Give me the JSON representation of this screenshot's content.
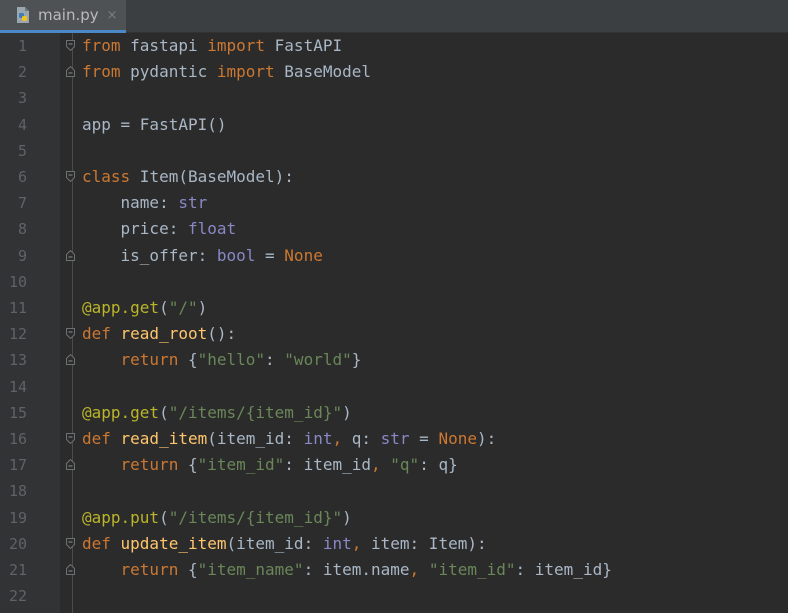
{
  "tab": {
    "filename": "main.py",
    "close_glyph": "×",
    "icon": "python-file-icon"
  },
  "theme": {
    "background": "#2b2b2b",
    "keyword": "#cc7832",
    "decorator": "#bbb529",
    "function": "#ffc66d",
    "string": "#6a8759",
    "builtin": "#8888c6",
    "text": "#a9b7c6"
  },
  "lines": [
    {
      "n": "1",
      "fold": "open",
      "tokens": [
        [
          "kw",
          "from"
        ],
        [
          "t",
          " fastapi "
        ],
        [
          "kw",
          "import"
        ],
        [
          "t",
          " FastAPI"
        ]
      ]
    },
    {
      "n": "2",
      "fold": "end",
      "tokens": [
        [
          "kw",
          "from"
        ],
        [
          "t",
          " pydantic "
        ],
        [
          "kw",
          "import"
        ],
        [
          "t",
          " BaseModel"
        ]
      ]
    },
    {
      "n": "3",
      "fold": "",
      "tokens": []
    },
    {
      "n": "4",
      "fold": "",
      "tokens": [
        [
          "t",
          "app = FastAPI()"
        ]
      ]
    },
    {
      "n": "5",
      "fold": "",
      "tokens": []
    },
    {
      "n": "6",
      "fold": "open",
      "tokens": [
        [
          "kw",
          "class"
        ],
        [
          "t",
          " Item(BaseModel):"
        ]
      ]
    },
    {
      "n": "7",
      "fold": "",
      "tokens": [
        [
          "t",
          "    name: "
        ],
        [
          "bi",
          "str"
        ]
      ]
    },
    {
      "n": "8",
      "fold": "",
      "tokens": [
        [
          "t",
          "    price: "
        ],
        [
          "bi",
          "float"
        ]
      ]
    },
    {
      "n": "9",
      "fold": "end",
      "tokens": [
        [
          "t",
          "    is_offer: "
        ],
        [
          "bi",
          "bool"
        ],
        [
          "t",
          " = "
        ],
        [
          "cst",
          "None"
        ]
      ]
    },
    {
      "n": "10",
      "fold": "",
      "tokens": []
    },
    {
      "n": "11",
      "fold": "",
      "tokens": [
        [
          "dec",
          "@app.get"
        ],
        [
          "t",
          "("
        ],
        [
          "str",
          "\"/\""
        ],
        [
          "t",
          ")"
        ]
      ]
    },
    {
      "n": "12",
      "fold": "open",
      "tokens": [
        [
          "kw",
          "def "
        ],
        [
          "fn",
          "read_root"
        ],
        [
          "t",
          "():"
        ]
      ]
    },
    {
      "n": "13",
      "fold": "end",
      "tokens": [
        [
          "t",
          "    "
        ],
        [
          "kw",
          "return"
        ],
        [
          "t",
          " {"
        ],
        [
          "str",
          "\"hello\""
        ],
        [
          "t",
          ": "
        ],
        [
          "str",
          "\"world\""
        ],
        [
          "t",
          "}"
        ]
      ]
    },
    {
      "n": "14",
      "fold": "",
      "tokens": []
    },
    {
      "n": "15",
      "fold": "",
      "tokens": [
        [
          "dec",
          "@app.get"
        ],
        [
          "t",
          "("
        ],
        [
          "str",
          "\"/items/{item_id}\""
        ],
        [
          "t",
          ")"
        ]
      ]
    },
    {
      "n": "16",
      "fold": "open",
      "tokens": [
        [
          "kw",
          "def "
        ],
        [
          "fn",
          "read_item"
        ],
        [
          "t",
          "(item_id: "
        ],
        [
          "bi",
          "int"
        ],
        [
          "kw",
          ","
        ],
        [
          "t",
          " q: "
        ],
        [
          "bi",
          "str"
        ],
        [
          "t",
          " = "
        ],
        [
          "cst",
          "None"
        ],
        [
          "t",
          "):"
        ]
      ]
    },
    {
      "n": "17",
      "fold": "end",
      "tokens": [
        [
          "t",
          "    "
        ],
        [
          "kw",
          "return"
        ],
        [
          "t",
          " {"
        ],
        [
          "str",
          "\"item_id\""
        ],
        [
          "t",
          ": item_id"
        ],
        [
          "kw",
          ","
        ],
        [
          "t",
          " "
        ],
        [
          "str",
          "\"q\""
        ],
        [
          "t",
          ": q}"
        ]
      ]
    },
    {
      "n": "18",
      "fold": "",
      "tokens": []
    },
    {
      "n": "19",
      "fold": "",
      "tokens": [
        [
          "dec",
          "@app.put"
        ],
        [
          "t",
          "("
        ],
        [
          "str",
          "\"/items/{item_id}\""
        ],
        [
          "t",
          ")"
        ]
      ]
    },
    {
      "n": "20",
      "fold": "open",
      "tokens": [
        [
          "kw",
          "def "
        ],
        [
          "fn",
          "update_item"
        ],
        [
          "t",
          "(item_id: "
        ],
        [
          "bi",
          "int"
        ],
        [
          "kw",
          ","
        ],
        [
          "t",
          " item: Item):"
        ]
      ]
    },
    {
      "n": "21",
      "fold": "end",
      "tokens": [
        [
          "t",
          "    "
        ],
        [
          "kw",
          "return"
        ],
        [
          "t",
          " {"
        ],
        [
          "str",
          "\"item_name\""
        ],
        [
          "t",
          ": item.name"
        ],
        [
          "kw",
          ","
        ],
        [
          "t",
          " "
        ],
        [
          "str",
          "\"item_id\""
        ],
        [
          "t",
          ": item_id}"
        ]
      ]
    },
    {
      "n": "22",
      "fold": "",
      "tokens": []
    }
  ]
}
